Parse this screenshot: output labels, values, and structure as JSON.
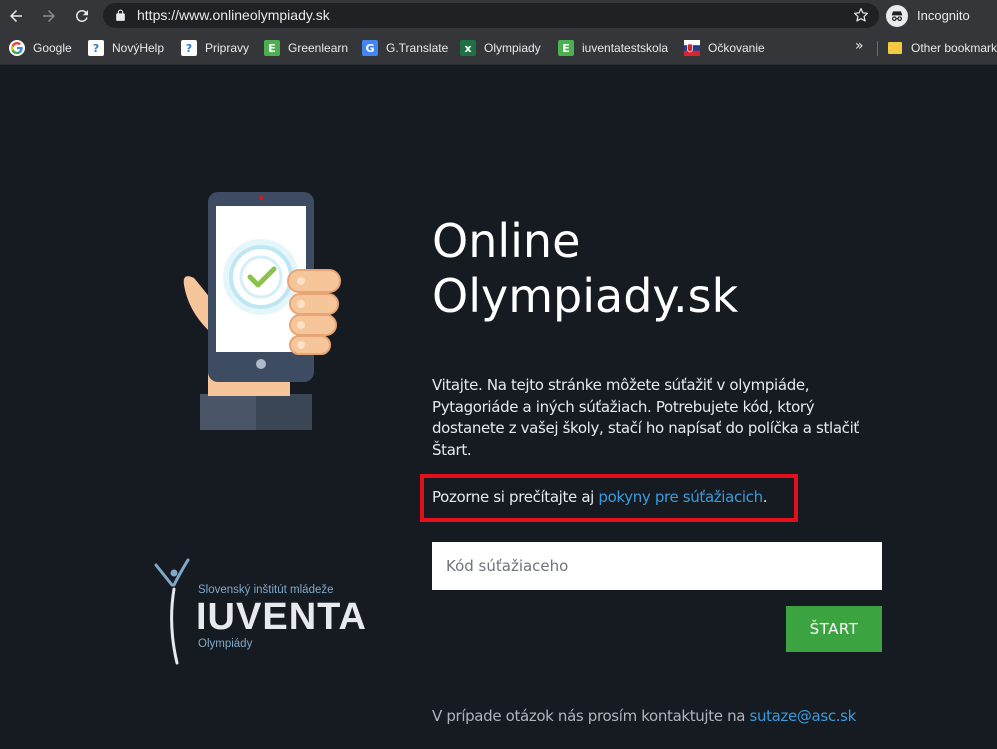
{
  "browser": {
    "url": "https://www.onlineolympiady.sk",
    "incognito_label": "Incognito",
    "bookmarks": [
      {
        "label": "Google",
        "icon": "google-icon",
        "color": "#ffffff"
      },
      {
        "label": "NovýHelp",
        "icon": "help-icon",
        "color": "#ffffff"
      },
      {
        "label": "Pripravy",
        "icon": "help-icon",
        "color": "#ffffff"
      },
      {
        "label": "Greenlearn",
        "icon": "greenlearn-icon",
        "color": "#4caf50"
      },
      {
        "label": "G.Translate",
        "icon": "translate-icon",
        "color": "#4285f4"
      },
      {
        "label": "Olympiady",
        "icon": "sheets-icon",
        "color": "#1e7145"
      },
      {
        "label": "iuventatestskola",
        "icon": "greenlearn-icon",
        "color": "#4caf50"
      },
      {
        "label": "Očkovanie",
        "icon": "slovak-flag-icon",
        "color": "#d5252f"
      }
    ],
    "more_label": "»",
    "other_bookmarks": "Other bookmarks"
  },
  "page": {
    "title_line1": "Online",
    "title_line2": "Olympiady.sk",
    "intro": "Vitajte. Na tejto stránke môžete súťažiť v olympiáde, Pytagoriáde a iných súťažiach. Potrebujete kód, ktorý dostanete z vašej školy, stačí ho napísať do políčka a stlačiť Štart.",
    "notice_text": "Pozorne si prečítajte aj ",
    "notice_link": "pokyny pre súťažiacich",
    "notice_end": ".",
    "code_placeholder": "Kód súťažiaceho",
    "start_label": "ŠTART",
    "contact_text": "V prípade otázok nás prosím kontaktujte na ",
    "contact_email": "sutaze@asc.sk",
    "logo": {
      "subtitle": "Slovenský inštitút mládeže",
      "name": "IUVENTA",
      "tagline": "Olympiády"
    }
  },
  "colors": {
    "page_bg": "#161b22",
    "link": "#3b9bd9",
    "start_button": "#3ba33f",
    "highlight_border": "#e3101b"
  }
}
